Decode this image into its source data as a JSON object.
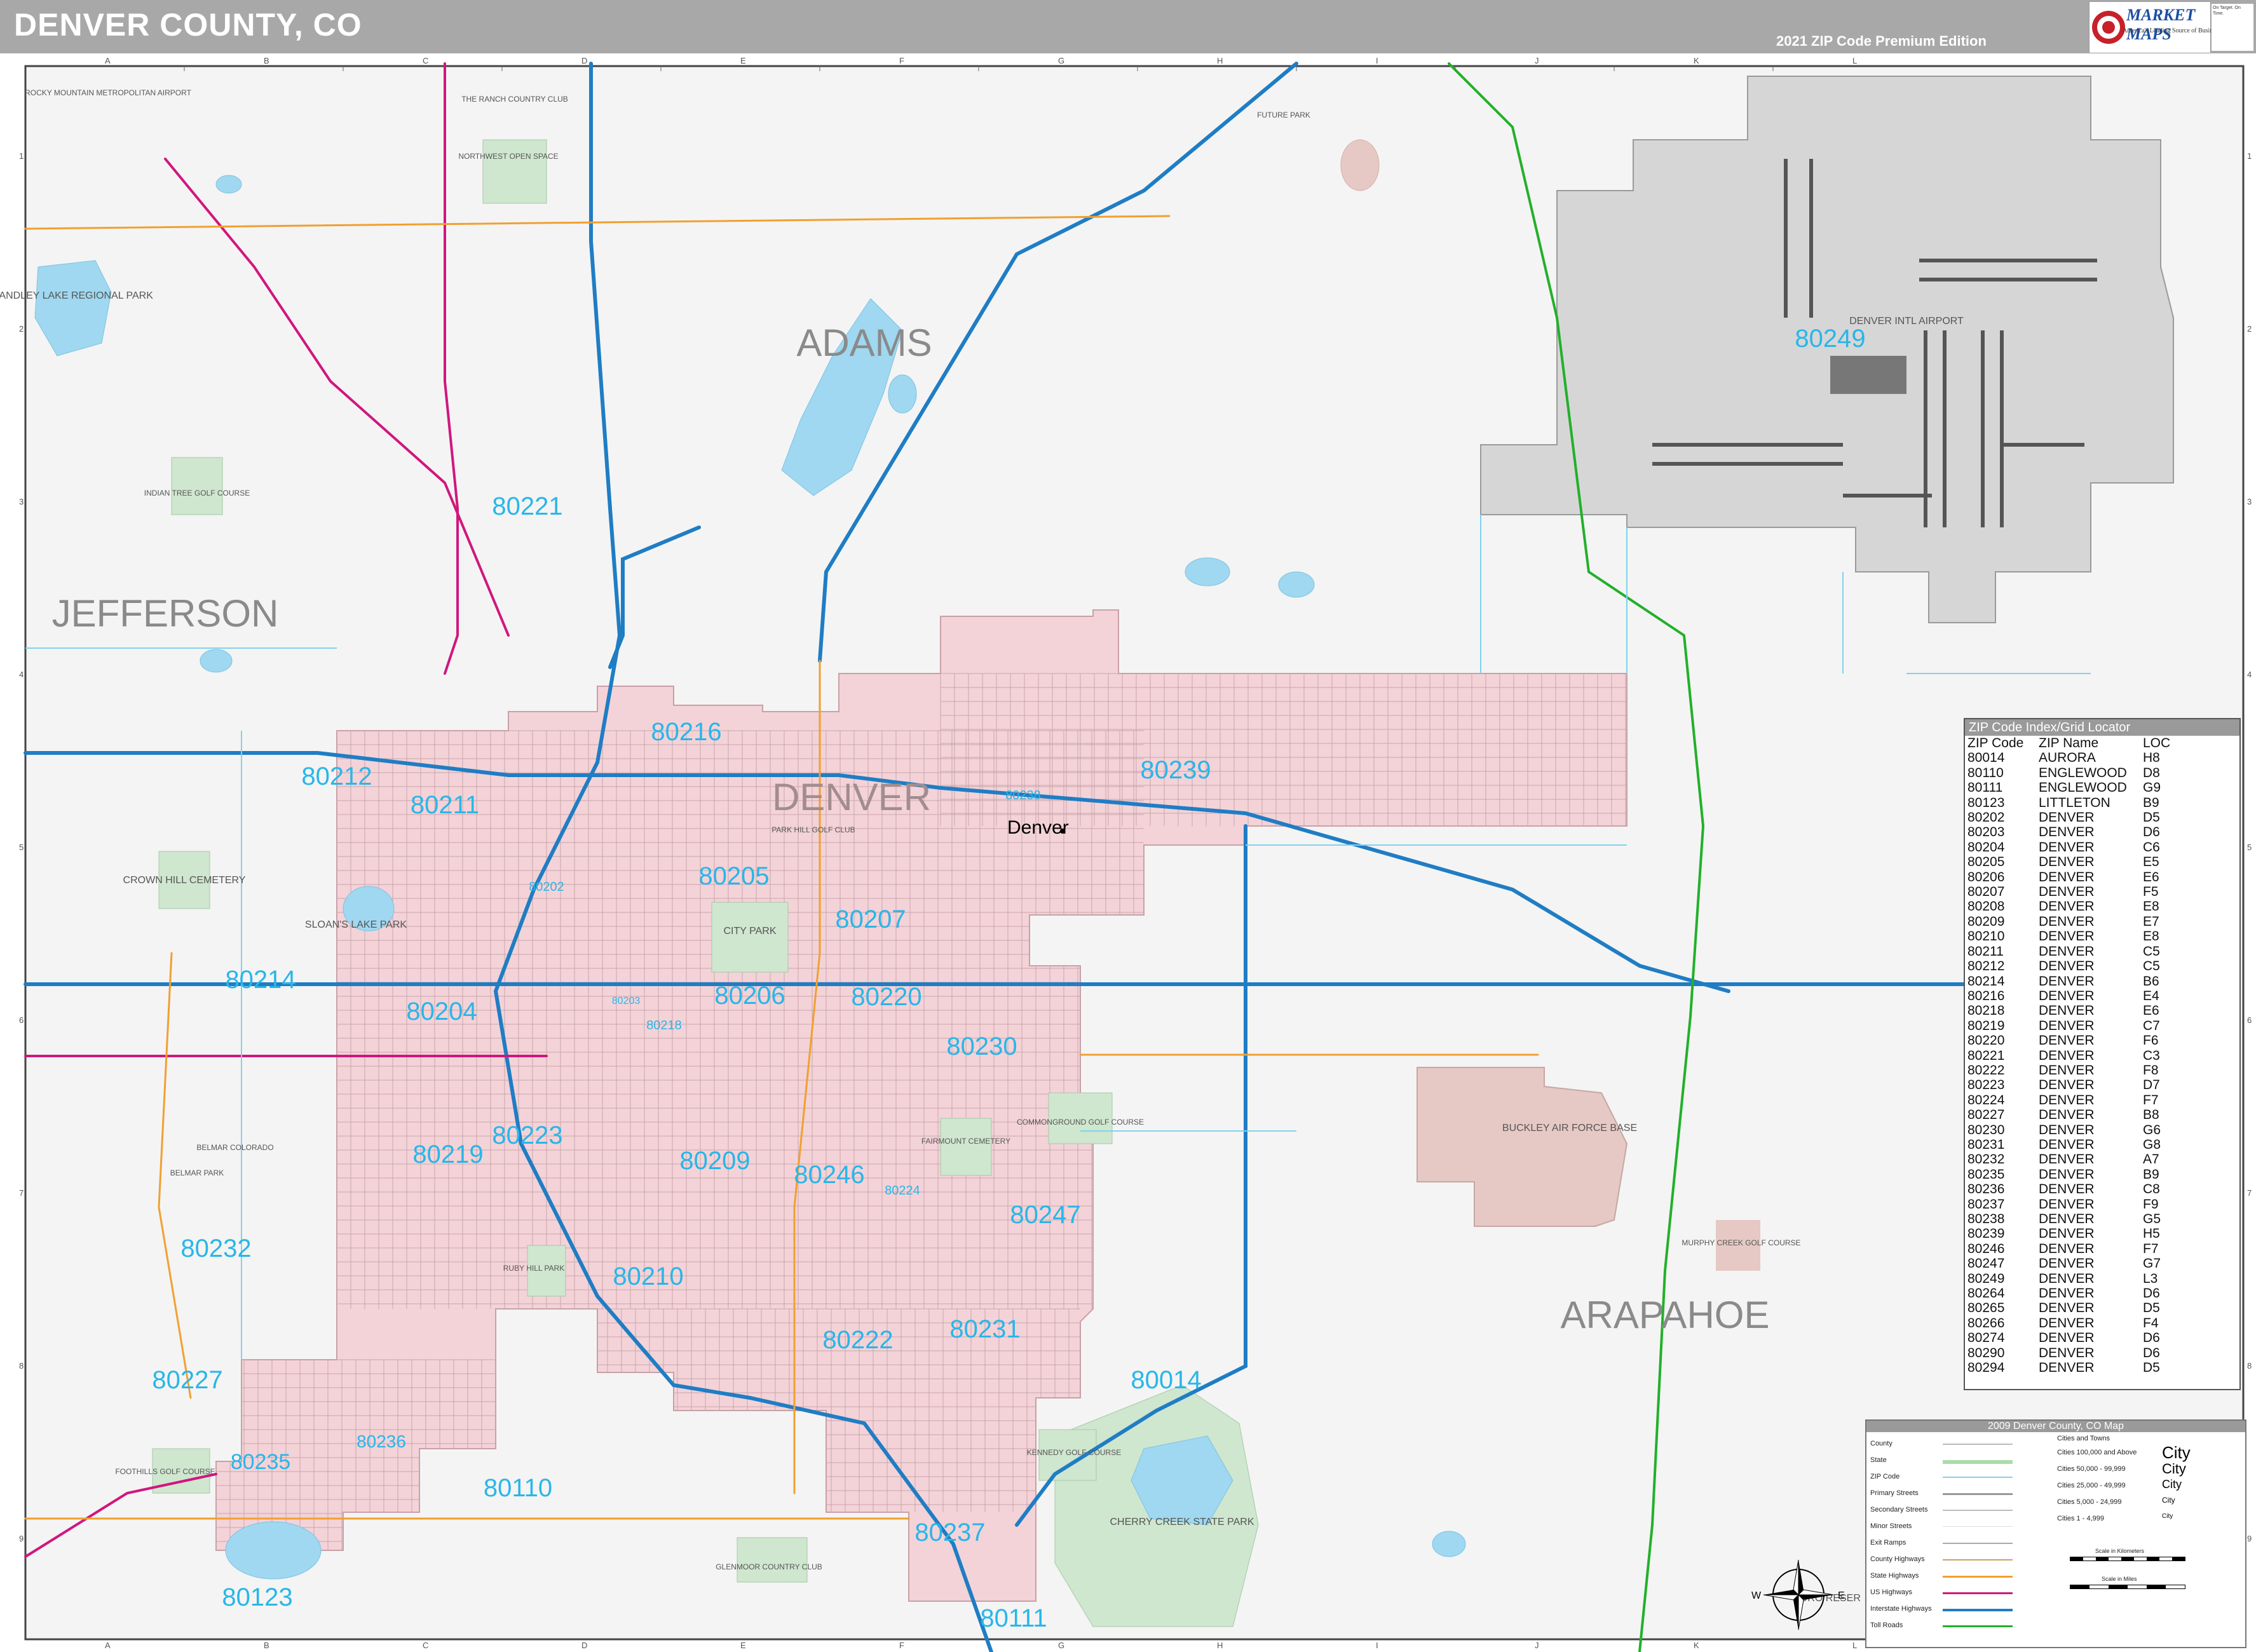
{
  "header": {
    "title": "DENVER COUNTY, CO",
    "edition": "2021 ZIP Code Premium Edition",
    "brand_name": "MARKET MAPS",
    "brand_tagline": "America's Leading Source of Business Maps",
    "brand_slogan": "On Target. On Time."
  },
  "grid": {
    "columns": [
      "A",
      "B",
      "C",
      "D",
      "E",
      "F",
      "G",
      "H",
      "I",
      "J",
      "K",
      "L"
    ],
    "rows": [
      "1",
      "2",
      "3",
      "4",
      "5",
      "6",
      "7",
      "8",
      "9"
    ]
  },
  "counties": [
    "ADAMS",
    "JEFFERSON",
    "DENVER",
    "ARAPAHOE"
  ],
  "zip_labels": [
    "80249",
    "80221",
    "80216",
    "80212",
    "80211",
    "80238",
    "80239",
    "80202",
    "80205",
    "80207",
    "80214",
    "80204",
    "80206",
    "80220",
    "80218",
    "80203",
    "80230",
    "80219",
    "80223",
    "80209",
    "80246",
    "80224",
    "80247",
    "80232",
    "80210",
    "80231",
    "80222",
    "80227",
    "80014",
    "80236",
    "80235",
    "80110",
    "80237",
    "80123",
    "80111"
  ],
  "place_labels": {
    "standley": "STANDLEY LAKE REGIONAL PARK",
    "airport": "DENVER INTL AIRPORT",
    "denver_city": "Denver",
    "city_park": "CITY PARK",
    "sloans": "SLOAN'S LAKE PARK",
    "crown_hill": "CROWN HILL CEMETERY",
    "buckley": "BUCKLEY AIR FORCE BASE",
    "cherry_creek": "CHERRY CREEK STATE PARK",
    "commonground": "COMMONGROUND GOLF COURSE",
    "fairmount": "FAIRMOUNT CEMETERY",
    "ranch": "THE RANCH COUNTRY CLUB",
    "northwest_open": "NORTHWEST OPEN SPACE",
    "indian_tree": "INDIAN TREE GOLF COURSE",
    "future_park": "FUTURE PARK",
    "rocky_mtn": "ROCKY MOUNTAIN METROPOLITAN AIRPORT",
    "murphy": "MURPHY CREEK GOLF COURSE",
    "belmar": "BELMAR PARK",
    "belmar_co": "BELMAR COLORADO",
    "foothills": "FOOTHILLS GOLF COURSE",
    "glenmoor": "GLENMOOR COUNTRY CLUB",
    "kennedy": "KENNEDY GOLF COURSE",
    "ruby_hill": "RUBY HILL PARK",
    "park_hill": "PARK HILL GOLF CLUB",
    "aurora_res": "AURO RESER"
  },
  "zip_index": {
    "title": "ZIP Code Index/Grid Locator",
    "headers": [
      "ZIP Code",
      "ZIP Name",
      "LOC"
    ],
    "rows": [
      [
        "80014",
        "AURORA",
        "H8"
      ],
      [
        "80110",
        "ENGLEWOOD",
        "D8"
      ],
      [
        "80111",
        "ENGLEWOOD",
        "G9"
      ],
      [
        "80123",
        "LITTLETON",
        "B9"
      ],
      [
        "80202",
        "DENVER",
        "D5"
      ],
      [
        "80203",
        "DENVER",
        "D6"
      ],
      [
        "80204",
        "DENVER",
        "C6"
      ],
      [
        "80205",
        "DENVER",
        "E5"
      ],
      [
        "80206",
        "DENVER",
        "E6"
      ],
      [
        "80207",
        "DENVER",
        "F5"
      ],
      [
        "80208",
        "DENVER",
        "E8"
      ],
      [
        "80209",
        "DENVER",
        "E7"
      ],
      [
        "80210",
        "DENVER",
        "E8"
      ],
      [
        "80211",
        "DENVER",
        "C5"
      ],
      [
        "80212",
        "DENVER",
        "C5"
      ],
      [
        "80214",
        "DENVER",
        "B6"
      ],
      [
        "80216",
        "DENVER",
        "E4"
      ],
      [
        "80218",
        "DENVER",
        "E6"
      ],
      [
        "80219",
        "DENVER",
        "C7"
      ],
      [
        "80220",
        "DENVER",
        "F6"
      ],
      [
        "80221",
        "DENVER",
        "C3"
      ],
      [
        "80222",
        "DENVER",
        "F8"
      ],
      [
        "80223",
        "DENVER",
        "D7"
      ],
      [
        "80224",
        "DENVER",
        "F7"
      ],
      [
        "80227",
        "DENVER",
        "B8"
      ],
      [
        "80230",
        "DENVER",
        "G6"
      ],
      [
        "80231",
        "DENVER",
        "G8"
      ],
      [
        "80232",
        "DENVER",
        "A7"
      ],
      [
        "80235",
        "DENVER",
        "B9"
      ],
      [
        "80236",
        "DENVER",
        "C8"
      ],
      [
        "80237",
        "DENVER",
        "F9"
      ],
      [
        "80238",
        "DENVER",
        "G5"
      ],
      [
        "80239",
        "DENVER",
        "H5"
      ],
      [
        "80246",
        "DENVER",
        "F7"
      ],
      [
        "80247",
        "DENVER",
        "G7"
      ],
      [
        "80249",
        "DENVER",
        "L3"
      ],
      [
        "80264",
        "DENVER",
        "D6"
      ],
      [
        "80265",
        "DENVER",
        "D5"
      ],
      [
        "80266",
        "DENVER",
        "F4"
      ],
      [
        "80274",
        "DENVER",
        "D6"
      ],
      [
        "80290",
        "DENVER",
        "D6"
      ],
      [
        "80294",
        "DENVER",
        "D5"
      ]
    ]
  },
  "legend": {
    "title": "2009 Denver County, CO Map",
    "items": [
      "County",
      "State",
      "ZIP Code",
      "Primary Streets",
      "Secondary Streets",
      "Minor Streets",
      "Exit Ramps",
      "County Highways",
      "State Highways",
      "US Highways",
      "Interstate Highways",
      "Toll Roads"
    ],
    "cities_title": "Cities and Towns",
    "cities": [
      "Cities 100,000 and Above",
      "Cities 50,000 - 99,999",
      "Cities 25,000 - 49,999",
      "Cities 5,000 - 24,999",
      "Cities 1 - 4,999"
    ],
    "city_sample": "City",
    "scale_km": "Scale in Kilometers",
    "scale_mi": "Scale in Miles"
  },
  "colors": {
    "denver_fill": "#f3d3d8",
    "airport_fill": "#d4d4d4",
    "water": "#9fd8f0",
    "park": "#cfe6cf",
    "interstate": "#1f7dc4",
    "us_highway": "#d1167e",
    "state_highway": "#f0a030",
    "toll": "#22b02a",
    "zip_text": "#29b6e8",
    "county_text": "#8a8a8a"
  }
}
